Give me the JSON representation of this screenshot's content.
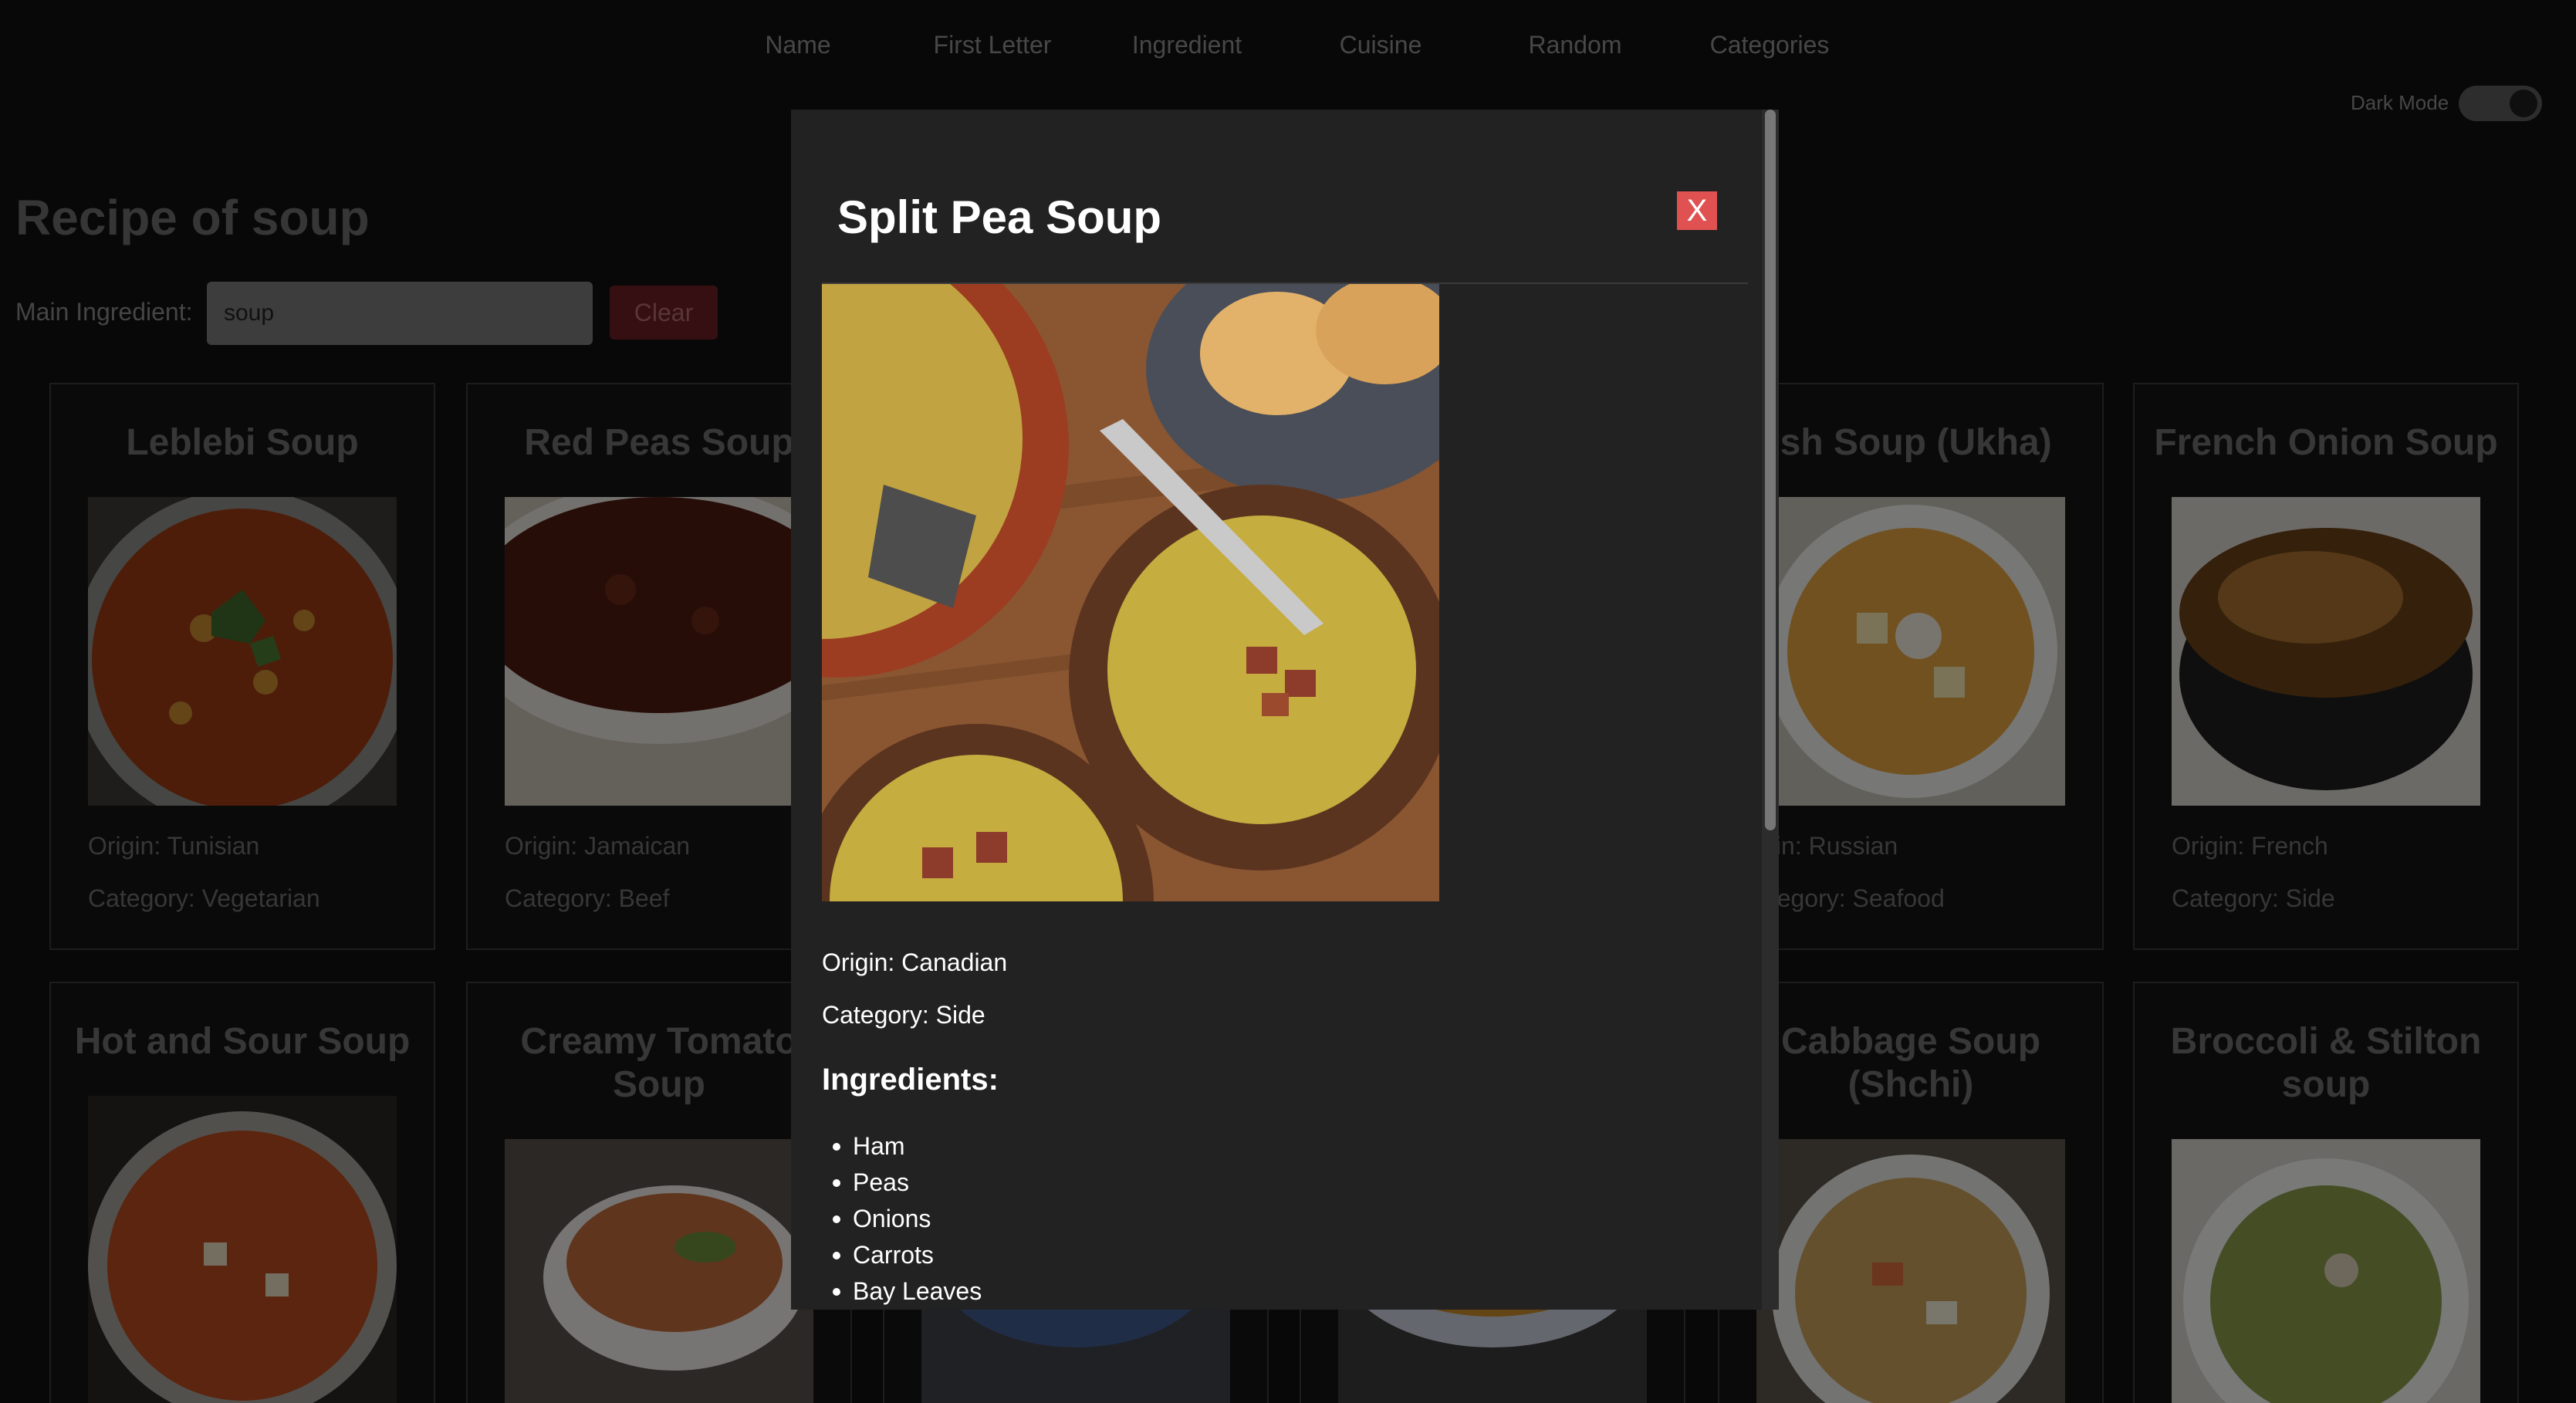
{
  "nav": {
    "items": [
      "Name",
      "First Letter",
      "Ingredient",
      "Cuisine",
      "Random",
      "Categories"
    ],
    "dark_mode_label": "Dark Mode",
    "dark_mode_on": true
  },
  "page": {
    "title": "Recipe of soup",
    "search_label": "Main Ingredient:",
    "search_value": "soup",
    "clear_label": "Clear"
  },
  "cards": [
    {
      "title": "Leblebi Soup",
      "origin": "Origin: Tunisian",
      "category": "Category: Vegetarian"
    },
    {
      "title": "Red Peas Soup",
      "origin": "Origin: Jamaican",
      "category": "Category: Beef"
    },
    {
      "title": "ish Soup (Ukha)",
      "origin": "igin: Russian",
      "category": "ategory: Seafood"
    },
    {
      "title": "French Onion Soup",
      "origin": "Origin: French",
      "category": "Category: Side"
    },
    {
      "title": "Hot and Sour Soup"
    },
    {
      "title": "Creamy Tomato\nSoup"
    },
    {
      "title": "Cabbage Soup\n(Shchi)"
    },
    {
      "title": "Broccoli & Stilton\nsoup"
    }
  ],
  "modal": {
    "title": "Split Pea Soup",
    "close_label": "X",
    "origin": "Origin: Canadian",
    "category": "Category: Side",
    "ingredients_heading": "Ingredients:",
    "ingredients": [
      "Ham",
      "Peas",
      "Onions",
      "Carrots",
      "Bay Leaves"
    ]
  },
  "colors": {
    "close_button": "#e05252",
    "modal_bg": "#222222",
    "clear_button": "#6b1f22"
  }
}
